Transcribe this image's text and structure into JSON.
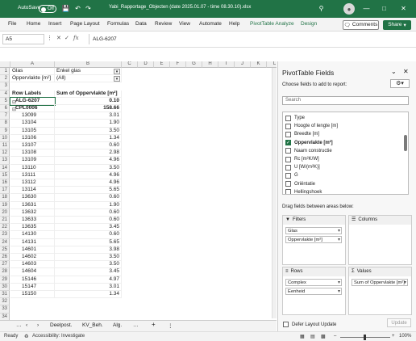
{
  "titlebar": {
    "autosave_label": "AutoSave",
    "autosave_state": "Off",
    "filename": "Yabi_Rapportage_Objecten (date 2025.01.07 - time 08.30.10).xlsx"
  },
  "menu": [
    "File",
    "Home",
    "Insert",
    "Page Layout",
    "Formulas",
    "Data",
    "Review",
    "View",
    "Automate",
    "Help",
    "PivotTable Analyze",
    "Design"
  ],
  "comments_label": "Comments",
  "share_label": "Share",
  "formula": {
    "name_box": "A5",
    "fx": "fx",
    "value": "ALG-6207"
  },
  "columns": [
    "A",
    "B",
    "C",
    "D",
    "E",
    "F",
    "G",
    "H",
    "I",
    "J",
    "K",
    "L"
  ],
  "filters": [
    {
      "label": "Glas",
      "value": "Enkel glas"
    },
    {
      "label": "Oppervlakte [m²]",
      "value": "(All)"
    }
  ],
  "pivot_header": {
    "row_labels": "Row Labels",
    "sum": "Sum of Oppervlakte [m²]"
  },
  "pivot_rows": [
    {
      "label": "ALG-6207",
      "value": "0.10",
      "level": 0
    },
    {
      "label": "CPL0006",
      "value": "158.66",
      "level": 0
    },
    {
      "label": "13099",
      "value": "3.01",
      "level": 1
    },
    {
      "label": "13104",
      "value": "1.90",
      "level": 1
    },
    {
      "label": "13105",
      "value": "3.50",
      "level": 1
    },
    {
      "label": "13106",
      "value": "1.34",
      "level": 1
    },
    {
      "label": "13107",
      "value": "0.60",
      "level": 1
    },
    {
      "label": "13108",
      "value": "2.98",
      "level": 1
    },
    {
      "label": "13109",
      "value": "4.96",
      "level": 1
    },
    {
      "label": "13110",
      "value": "3.50",
      "level": 1
    },
    {
      "label": "13111",
      "value": "4.96",
      "level": 1
    },
    {
      "label": "13112",
      "value": "4.96",
      "level": 1
    },
    {
      "label": "13114",
      "value": "5.65",
      "level": 1
    },
    {
      "label": "13630",
      "value": "0.60",
      "level": 1
    },
    {
      "label": "13631",
      "value": "1.90",
      "level": 1
    },
    {
      "label": "13632",
      "value": "0.60",
      "level": 1
    },
    {
      "label": "13633",
      "value": "0.60",
      "level": 1
    },
    {
      "label": "13635",
      "value": "3.45",
      "level": 1
    },
    {
      "label": "14130",
      "value": "0.60",
      "level": 1
    },
    {
      "label": "14131",
      "value": "5.65",
      "level": 1
    },
    {
      "label": "14601",
      "value": "3.98",
      "level": 1
    },
    {
      "label": "14602",
      "value": "3.50",
      "level": 1
    },
    {
      "label": "14603",
      "value": "3.50",
      "level": 1
    },
    {
      "label": "14604",
      "value": "3.45",
      "level": 1
    },
    {
      "label": "15146",
      "value": "4.97",
      "level": 1
    },
    {
      "label": "15147",
      "value": "3.01",
      "level": 1
    },
    {
      "label": "15150",
      "value": "1.34",
      "level": 1
    }
  ],
  "sheet_tabs": [
    "Deelpost.",
    "KV_Beh.",
    "Alg."
  ],
  "status": {
    "ready": "Ready",
    "accessibility": "Accessibility: Investigate",
    "zoom": "100%"
  },
  "panel": {
    "title": "PivotTable Fields",
    "choose": "Choose fields to add to report:",
    "search_placeholder": "Search",
    "fields": [
      {
        "name": "Type",
        "checked": false
      },
      {
        "name": "Hoogte of lengte [m]",
        "checked": false
      },
      {
        "name": "Breedte [m]",
        "checked": false
      },
      {
        "name": "Oppervlakte [m²]",
        "checked": true
      },
      {
        "name": "Naam constructie",
        "checked": false
      },
      {
        "name": "Rc [m²K/W]",
        "checked": false
      },
      {
        "name": "U [W/(m²K)]",
        "checked": false
      },
      {
        "name": "G",
        "checked": false
      },
      {
        "name": "Oriëntatie",
        "checked": false
      },
      {
        "name": "Hellingshoek",
        "checked": false
      }
    ],
    "drag_label": "Drag fields between areas below:",
    "areas": {
      "filters": {
        "title": "Filters",
        "items": [
          "Glas",
          "Oppervlakte [m²]"
        ]
      },
      "columns": {
        "title": "Columns",
        "items": []
      },
      "rows": {
        "title": "Rows",
        "items": [
          "Complex",
          "Eenheid"
        ]
      },
      "values": {
        "title": "Values",
        "items": [
          "Sum of Oppervlakte [m²]"
        ]
      }
    },
    "defer_label": "Defer Layout Update",
    "update_label": "Update"
  },
  "colors": {
    "excel_green": "#217346"
  }
}
